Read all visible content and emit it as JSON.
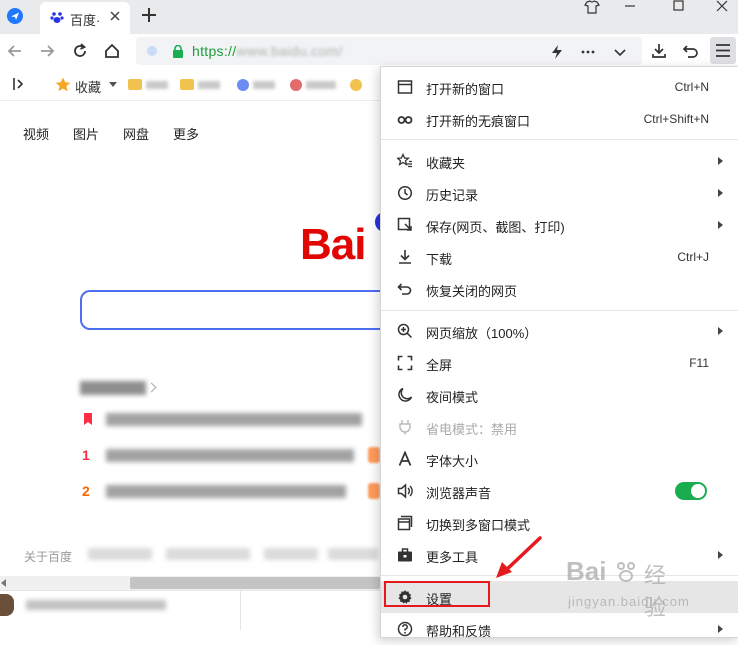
{
  "tab": {
    "title": "百度·"
  },
  "address": {
    "url_visible": "https://",
    "url_blurred": "www.baidu.com/"
  },
  "bookmarks": {
    "favorites_label": "收藏"
  },
  "page": {
    "nav": [
      "视频",
      "图片",
      "网盘",
      "更多"
    ],
    "logo_text": "Bai",
    "hot_numbers": [
      "1",
      "2"
    ],
    "footer_text": "关于百度"
  },
  "menu": {
    "items": [
      {
        "label": "打开新的窗口",
        "shortcut": "Ctrl+N",
        "icon": "window-icon"
      },
      {
        "label": "打开新的无痕窗口",
        "shortcut": "Ctrl+Shift+N",
        "icon": "incognito-icon"
      },
      {
        "label": "收藏夹",
        "icon": "favorites-star-icon",
        "submenu": true
      },
      {
        "label": "历史记录",
        "icon": "history-clock-icon",
        "submenu": true
      },
      {
        "label": "保存(网页、截图、打印)",
        "icon": "save-page-icon",
        "submenu": true
      },
      {
        "label": "下载",
        "shortcut": "Ctrl+J",
        "icon": "download-icon"
      },
      {
        "label": "恢复关闭的网页",
        "icon": "restore-icon"
      },
      {
        "label": "网页缩放（100%）",
        "icon": "zoom-icon",
        "submenu": true
      },
      {
        "label": "全屏",
        "shortcut": "F11",
        "icon": "fullscreen-icon"
      },
      {
        "label": "夜间模式",
        "icon": "moon-icon"
      },
      {
        "label": "省电模式：禁用",
        "icon": "power-saver-icon",
        "disabled": true
      },
      {
        "label": "字体大小",
        "icon": "font-size-icon"
      },
      {
        "label": "浏览器声音",
        "icon": "speaker-icon",
        "toggle": true,
        "toggle_on": true
      },
      {
        "label": "切换到多窗口模式",
        "icon": "multi-window-icon"
      },
      {
        "label": "更多工具",
        "icon": "toolbox-icon",
        "submenu": true
      },
      {
        "label": "设置",
        "icon": "settings-gear-icon",
        "highlighted": true
      },
      {
        "label": "帮助和反馈",
        "icon": "help-icon",
        "submenu": true
      }
    ]
  },
  "watermark": {
    "brand": "Bai",
    "brand2": "经验",
    "url": "jingyan.baidu.com"
  },
  "colors": {
    "accent_green": "#1aad50",
    "highlight_red": "#e5191e",
    "baidu_red": "#e10602",
    "baidu_blue": "#2932e1"
  }
}
